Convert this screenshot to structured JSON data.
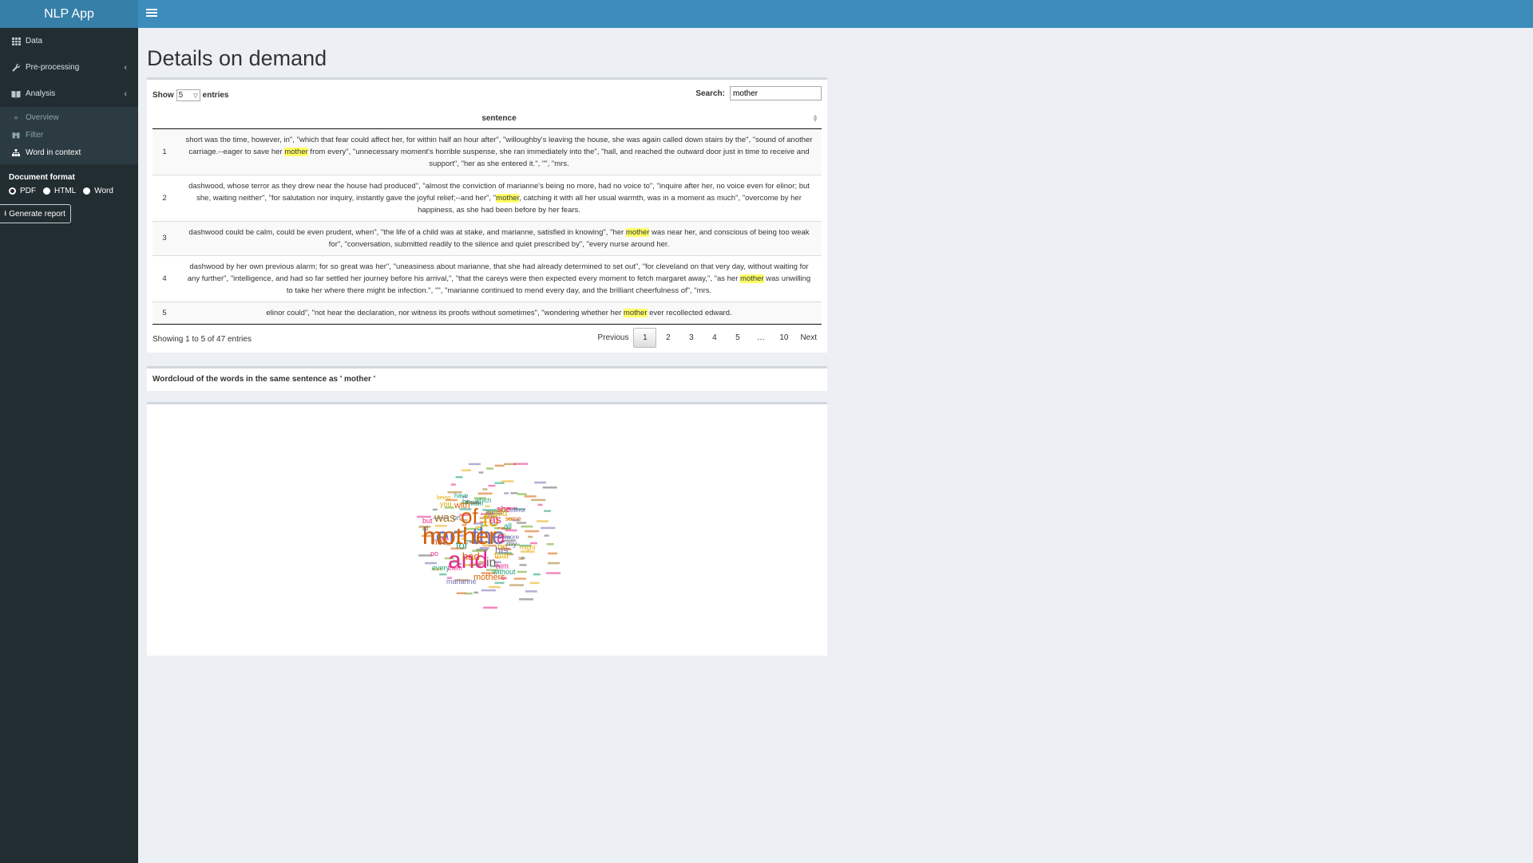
{
  "app": {
    "title": "NLP App"
  },
  "sidebar": {
    "items": [
      {
        "label": "Data",
        "icon": "table-icon"
      },
      {
        "label": "Pre-processing",
        "icon": "wrench-icon"
      },
      {
        "label": "Analysis",
        "icon": "book-icon"
      }
    ],
    "subitems": [
      {
        "label": "Overview",
        "icon": "angle-double-right-icon"
      },
      {
        "label": "Filter",
        "icon": "binoculars-icon"
      },
      {
        "label": "Word in context",
        "icon": "sitemap-icon",
        "active": true
      }
    ],
    "doc_format_title": "Document format",
    "formats": [
      "PDF",
      "HTML",
      "Word"
    ],
    "selected_format": "PDF",
    "generate_label": "Generate report"
  },
  "main": {
    "title": "Details on demand",
    "table": {
      "show_label": "Show",
      "length_value": "5",
      "entries_label": "entries",
      "search_label": "Search:",
      "search_value": "mother",
      "column": "sentence",
      "rows": [
        {
          "n": "1",
          "pre": "short was the time, however, in\", \"which that fear could affect her, for within half an hour after\", \"willoughby's leaving the house, she was again called down stairs by the\", \"sound of another carriage.--eager to save her ",
          "hl": "mother",
          "post": " from every\", \"unnecessary moment's horrible suspense, she ran immediately into the\", \"hall, and reached the outward door just in time to receive and support\", \"her as she entered it.\", \"\", \"mrs."
        },
        {
          "n": "2",
          "pre": "dashwood, whose terror as they drew near the house had produced\", \"almost the conviction of marianne's being no more, had no voice to\", \"inquire after her, no voice even for elinor; but she, waiting neither\", \"for salutation nor inquiry, instantly gave the joyful relief;--and her\", \"",
          "hl": "mother",
          "post": ", catching it with all her usual warmth, was in a moment as much\", \"overcome by her happiness, as she had been before by her fears."
        },
        {
          "n": "3",
          "pre": "dashwood could be calm, could be even prudent, when\", \"the life of a child was at stake, and marianne, satisfied in knowing\", \"her ",
          "hl": "mother",
          "post": " was near her, and conscious of being too weak for\", \"conversation, submitted readily to the silence and quiet prescribed by\", \"every nurse around her."
        },
        {
          "n": "4",
          "pre": "dashwood by her own previous alarm; for so great was her\", \"uneasiness about marianne, that she had already determined to set out\", \"for cleveland on that very day, without waiting for any further\", \"intelligence, and had so far settled her journey before his arrival,\", \"that the careys were then expected every moment to fetch margaret away,\", \"as her ",
          "hl": "mother",
          "post": " was unwilling to take her where there might be infection.\", \"\", \"marianne continued to mend every day, and the brilliant cheerfulness of\", \"mrs."
        },
        {
          "n": "5",
          "pre": "elinor could\", \"not hear the declaration, nor witness its proofs without sometimes\", \"wondering whether her ",
          "hl": "mother",
          "post": " ever recollected edward."
        }
      ],
      "info": "Showing 1 to 5 of 47 entries",
      "pagination": [
        "Previous",
        "1",
        "2",
        "3",
        "4",
        "5",
        "…",
        "10",
        "Next"
      ],
      "current_page": "1"
    },
    "wordcloud_title": "Wordcloud of the words in the same sentence as ' mother '",
    "wordcloud_words": [
      {
        "text": "her",
        "color": "#7570b3"
      },
      {
        "text": "the",
        "color": "#7570b3"
      },
      {
        "text": "and",
        "color": "#e7298a"
      },
      {
        "text": "of",
        "color": "#d95f02"
      },
      {
        "text": "to",
        "color": "#e6ab02"
      },
      {
        "text": "was",
        "color": "#a6761d"
      },
      {
        "text": "a",
        "color": "#e7298a"
      },
      {
        "text": "in",
        "color": "#666666"
      },
      {
        "text": "his",
        "color": "#7570b3"
      },
      {
        "text": "as",
        "color": "#e7298a"
      },
      {
        "text": "had",
        "color": "#d95f02"
      },
      {
        "text": "for",
        "color": "#1b9e77"
      },
      {
        "text": "be",
        "color": "#e6ab02"
      },
      {
        "text": "that",
        "color": "#e6ab02"
      },
      {
        "text": "she",
        "color": "#e7298a"
      },
      {
        "text": "with",
        "color": "#d95f02"
      },
      {
        "text": "could",
        "color": "#e6ab02"
      },
      {
        "text": "he",
        "color": "#1b9e77"
      },
      {
        "text": "which",
        "color": "#1b9e77"
      },
      {
        "text": "my",
        "color": "#7570b3"
      },
      {
        "text": "all",
        "color": "#1b9e77"
      },
      {
        "text": "on",
        "color": "#666666"
      },
      {
        "text": "at",
        "color": "#a6761d"
      },
      {
        "text": "but",
        "color": "#e7298a"
      },
      {
        "text": "not",
        "color": "#d95f02"
      },
      {
        "text": "him",
        "color": "#e7298a"
      },
      {
        "text": "mothers",
        "color": "#d95f02"
      },
      {
        "text": "without",
        "color": "#1b9e77"
      },
      {
        "text": "every",
        "color": "#1b9e77"
      },
      {
        "text": "marianne",
        "color": "#7570b3"
      },
      {
        "text": "you",
        "color": "#e6ab02"
      },
      {
        "text": "an",
        "color": "#666666"
      },
      {
        "text": "no",
        "color": "#e7298a"
      },
      {
        "text": "more",
        "color": "#7570b3"
      },
      {
        "text": "some",
        "color": "#d95f02"
      },
      {
        "text": "might",
        "color": "#e6ab02"
      },
      {
        "text": "from",
        "color": "#1b9e77"
      },
      {
        "text": "so",
        "color": "#a6761d"
      },
      {
        "text": "them",
        "color": "#e7298a"
      },
      {
        "text": "there",
        "color": "#666666"
      },
      {
        "text": "have",
        "color": "#1b9e77"
      },
      {
        "text": "elinor",
        "color": "#7570b3"
      },
      {
        "text": "being",
        "color": "#e6ab02"
      },
      {
        "text": "mother",
        "color": "#d95f02"
      }
    ]
  }
}
